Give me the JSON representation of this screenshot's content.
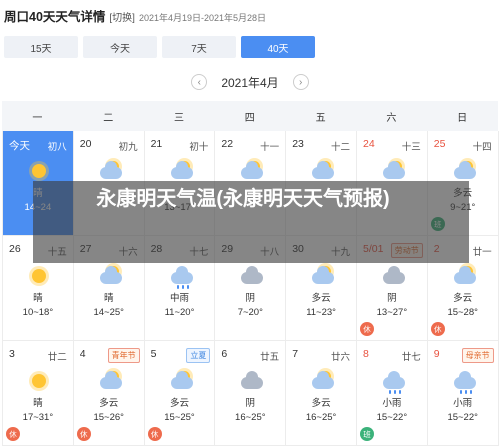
{
  "header": {
    "title": "周口40天天气详情",
    "switch": "[切换]",
    "range": "2021年4月19日-2021年5月28日"
  },
  "tabs": [
    "15天",
    "今天",
    "7天",
    "40天"
  ],
  "month": {
    "label": "2021年4月",
    "prev": "‹",
    "next": "›"
  },
  "weekdays": [
    "一",
    "二",
    "三",
    "四",
    "五",
    "六",
    "日"
  ],
  "days": [
    {
      "day": "今天",
      "lunar": "初八",
      "icon": "sunny",
      "cond": "晴",
      "temp": "14~24",
      "today": true
    },
    {
      "day": "20",
      "lunar": "初九",
      "icon": "cloudy",
      "cond": "",
      "temp": ""
    },
    {
      "day": "21",
      "lunar": "初十",
      "icon": "cloudy",
      "cond": "",
      "temp": "13~17°"
    },
    {
      "day": "22",
      "lunar": "十一",
      "icon": "cloudy",
      "cond": "",
      "temp": ""
    },
    {
      "day": "23",
      "lunar": "十二",
      "icon": "cloudy",
      "cond": "",
      "temp": ""
    },
    {
      "day": "24",
      "lunar": "十三",
      "icon": "cloudy",
      "cond": "",
      "temp": "",
      "red": true
    },
    {
      "day": "25",
      "lunar": "十四",
      "icon": "cloudy",
      "cond": "多云",
      "temp": "9~21°",
      "red": true,
      "badge": "班",
      "badge_type": "work"
    },
    {
      "day": "26",
      "lunar": "十五",
      "icon": "sunny",
      "cond": "晴",
      "temp": "10~18°"
    },
    {
      "day": "27",
      "lunar": "十六",
      "icon": "cloudy",
      "cond": "晴",
      "temp": "14~25°"
    },
    {
      "day": "28",
      "lunar": "十七",
      "icon": "rain",
      "cond": "中雨",
      "temp": "11~20°"
    },
    {
      "day": "29",
      "lunar": "十八",
      "icon": "overcast",
      "cond": "阴",
      "temp": "7~20°"
    },
    {
      "day": "30",
      "lunar": "十九",
      "icon": "cloudy",
      "cond": "多云",
      "temp": "11~23°"
    },
    {
      "day": "5/01",
      "festival": "劳动节",
      "icon": "overcast",
      "cond": "阴",
      "temp": "13~27°",
      "red": true,
      "badge": "休",
      "badge_type": "rest"
    },
    {
      "day": "2",
      "lunar": "廿一",
      "icon": "cloudy",
      "cond": "多云",
      "temp": "15~28°",
      "red": true,
      "badge": "休",
      "badge_type": "rest"
    },
    {
      "day": "3",
      "lunar": "廿二",
      "icon": "sunny",
      "cond": "晴",
      "temp": "17~31°",
      "badge": "休",
      "badge_type": "rest"
    },
    {
      "day": "4",
      "festival": "青年节",
      "icon": "cloudy",
      "cond": "多云",
      "temp": "15~26°",
      "badge": "休",
      "badge_type": "rest"
    },
    {
      "day": "5",
      "festival": "立夏",
      "festival_blue": true,
      "icon": "cloudy",
      "cond": "多云",
      "temp": "15~25°",
      "badge": "休",
      "badge_type": "rest"
    },
    {
      "day": "6",
      "lunar": "廿五",
      "icon": "overcast",
      "cond": "阴",
      "temp": "16~25°"
    },
    {
      "day": "7",
      "lunar": "廿六",
      "icon": "cloudy",
      "cond": "多云",
      "temp": "16~25°"
    },
    {
      "day": "8",
      "lunar": "廿七",
      "icon": "rain",
      "cond": "小雨",
      "temp": "15~22°",
      "red": true,
      "badge": "班",
      "badge_type": "work"
    },
    {
      "day": "9",
      "festival": "母亲节",
      "icon": "rain",
      "cond": "小雨",
      "temp": "15~22°",
      "red": true
    }
  ],
  "overlay": {
    "text": "永康明天气温(永康明天天气预报)"
  },
  "colors": {
    "accent": "#4b8ef2",
    "holiday": "#e8523f",
    "rest_badge": "#ee6b4d",
    "work_badge": "#3bb27a"
  }
}
